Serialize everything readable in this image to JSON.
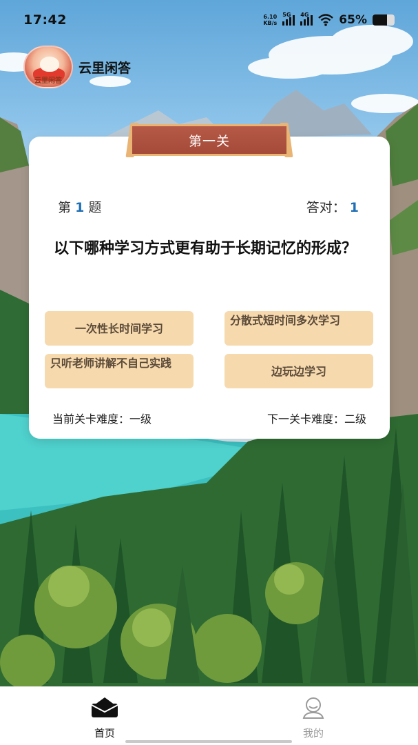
{
  "status_bar": {
    "time": "17:42",
    "net_speed_value": "6.10",
    "net_speed_unit": "KB/s",
    "signal_1_label": "5G",
    "signal_2_label": "4G",
    "battery_text": "65%",
    "battery_level": 0.65
  },
  "header": {
    "logo_text": "云里闲答",
    "app_name": "云里闲答"
  },
  "quiz": {
    "level_title": "第一关",
    "question_prefix": "第",
    "question_number": "1",
    "question_suffix": "题",
    "correct_label": "答对：",
    "correct_count": "1",
    "question_text": "以下哪种学习方式更有助于长期记忆的形成？",
    "options": [
      {
        "label": "一次性长时间学习"
      },
      {
        "label": "分散式短时间多次学习"
      },
      {
        "label": "只听老师讲解不自己实践"
      },
      {
        "label": "边玩边学习"
      }
    ],
    "current_difficulty": "当前关卡难度：一级",
    "next_difficulty": "下一关卡难度：二级"
  },
  "bottom_nav": {
    "items": [
      {
        "label": "首页",
        "icon": "home-icon",
        "active": true
      },
      {
        "label": "我的",
        "icon": "user-icon",
        "active": false
      }
    ]
  },
  "colors": {
    "option_bg": "#f7d9ae",
    "banner": "#a54a39",
    "accent_number": "#1f6fb5"
  }
}
